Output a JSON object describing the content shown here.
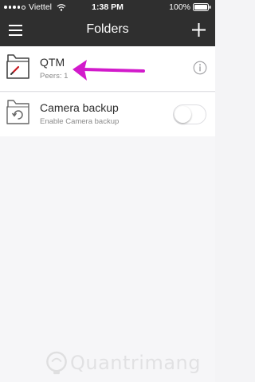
{
  "status_bar": {
    "carrier": "Viettel",
    "time": "1:38 PM",
    "battery": "100%",
    "signal_icon": "signal-dots-icon",
    "wifi_icon": "wifi-icon",
    "battery_icon": "battery-full-icon"
  },
  "nav": {
    "title": "Folders",
    "menu_icon": "hamburger-menu-icon",
    "add_icon": "plus-icon"
  },
  "folders": [
    {
      "name": "QTM",
      "status": "Peers: 1",
      "icon": "folder-with-pencil-icon",
      "action_icon": "info-icon"
    },
    {
      "name": "Camera backup",
      "status": "Enable Camera backup",
      "icon": "folder-with-sync-icon",
      "toggle_on": false
    }
  ],
  "annotation": {
    "arrow_icon": "pointer-arrow-icon",
    "color": "#d21acb"
  },
  "watermark": {
    "text": "Quantrimang",
    "icon": "lightbulb-icon"
  },
  "colors": {
    "navbar": "#2f2f2f",
    "background": "#f6f6f8",
    "row": "#ffffff",
    "title_text": "#2d2d2d",
    "subtitle_text": "#8a8a8a"
  }
}
